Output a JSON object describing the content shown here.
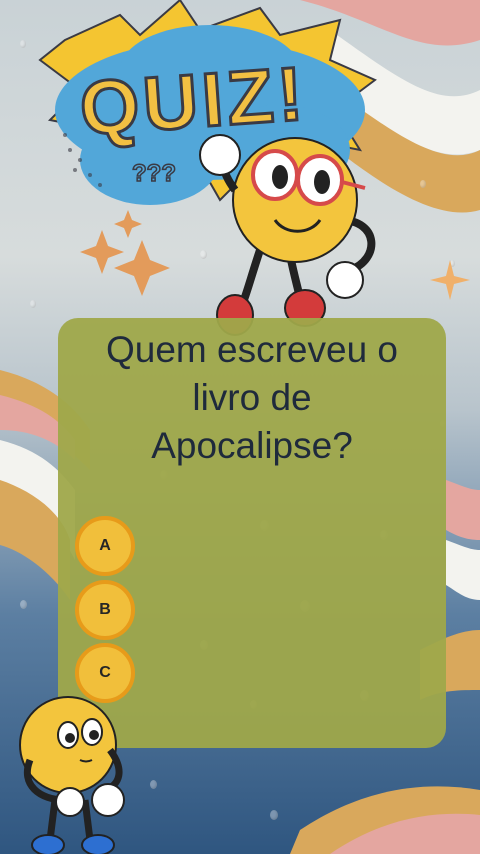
{
  "title": {
    "text": "QUIZ!",
    "question_marks": "???"
  },
  "question": {
    "line1": "Quem escreveu o",
    "line2": "livro de",
    "line3": "Apocalipse?"
  },
  "options": [
    {
      "label": "A"
    },
    {
      "label": "B"
    },
    {
      "label": "C"
    }
  ],
  "colors": {
    "card": "#9fa84a",
    "option_fill": "#f1bf3b",
    "option_border": "#e79b1a",
    "question_text": "#1f2a3c",
    "title_fill": "#f2c043",
    "title_outline": "#3a3a44"
  },
  "icons": [
    "sparkle-icon",
    "sun-mascot-waving",
    "sun-mascot-thinking"
  ]
}
